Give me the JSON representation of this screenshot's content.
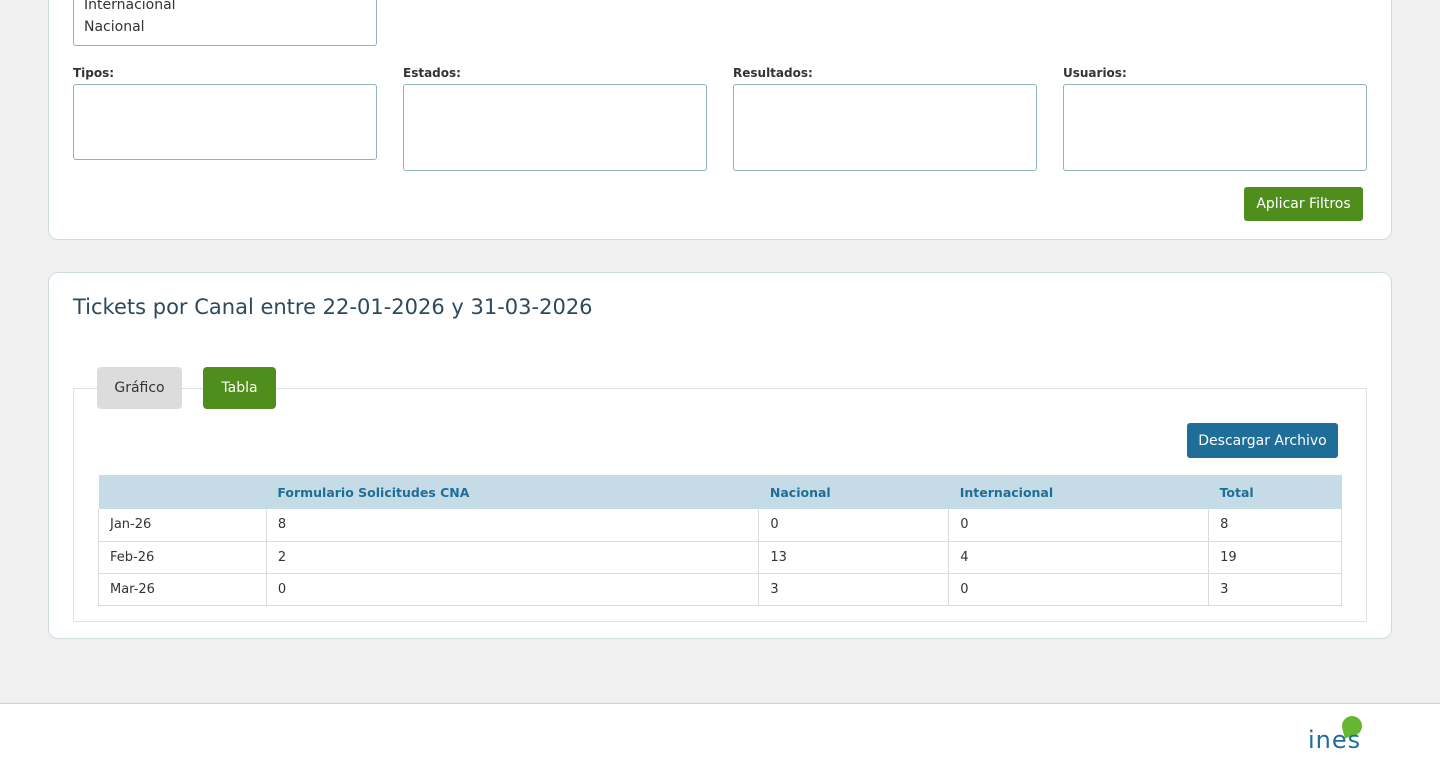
{
  "filters": {
    "channel_options": [
      "Internacional",
      "Nacional"
    ],
    "tipos_label": "Tipos:",
    "estados_label": "Estados:",
    "resultados_label": "Resultados:",
    "usuarios_label": "Usuarios:",
    "apply_label": "Aplicar Filtros"
  },
  "report": {
    "title": "Tickets por Canal entre 22-01-2026 y 31-03-2026",
    "tabs": [
      {
        "label": "Gráfico",
        "active": false
      },
      {
        "label": "Tabla",
        "active": true
      }
    ],
    "download_label": "Descargar Archivo",
    "table": {
      "headers": [
        "",
        "Formulario Solicitudes CNA",
        "Nacional",
        "Internacional",
        "Total"
      ],
      "rows": [
        [
          "Jan-26",
          "8",
          "0",
          "0",
          "8"
        ],
        [
          "Feb-26",
          "2",
          "13",
          "4",
          "19"
        ],
        [
          "Mar-26",
          "0",
          "3",
          "0",
          "3"
        ]
      ]
    }
  },
  "footer": {
    "logo_text": "ines"
  },
  "colors": {
    "accent_green": "#4f8e1c",
    "accent_blue": "#1f6e99",
    "header_bg": "#c5dce6"
  }
}
